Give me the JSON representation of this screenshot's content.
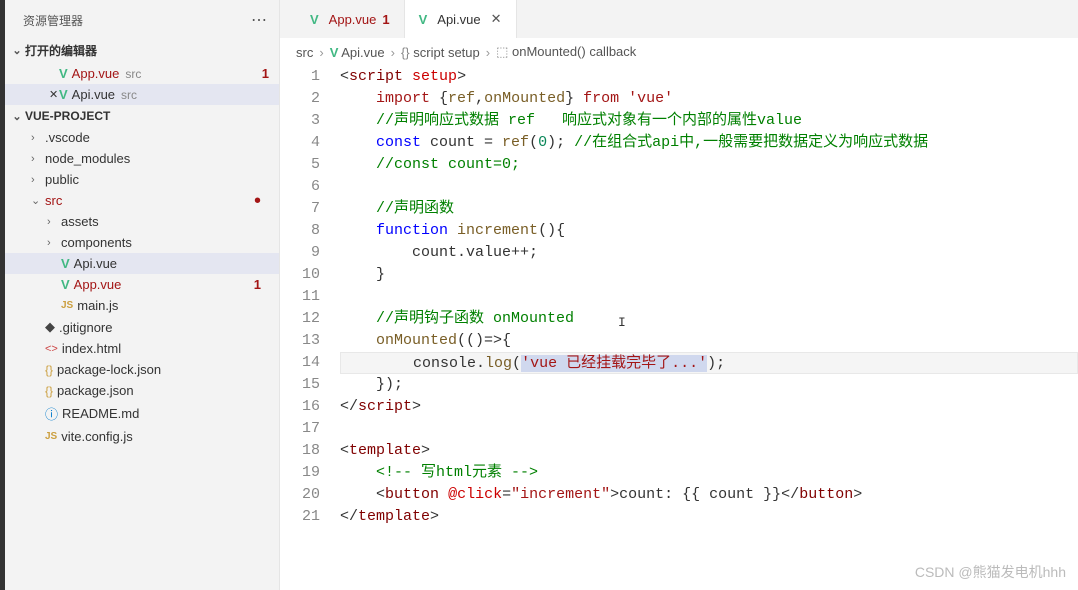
{
  "sidebar": {
    "title": "资源管理器",
    "openEditorsLabel": "打开的编辑器",
    "projectLabel": "VUE-PROJECT",
    "openEditors": [
      {
        "name": "App.vue",
        "folder": "src",
        "badge": "1",
        "modified": true
      },
      {
        "name": "Api.vue",
        "folder": "src",
        "active": true
      }
    ],
    "tree": [
      {
        "label": ".vscode",
        "type": "folder",
        "depth": 1
      },
      {
        "label": "node_modules",
        "type": "folder",
        "depth": 1
      },
      {
        "label": "public",
        "type": "folder",
        "depth": 1
      },
      {
        "label": "src",
        "type": "folder",
        "depth": 1,
        "open": true,
        "modified": true,
        "dot": true
      },
      {
        "label": "assets",
        "type": "folder",
        "depth": 2
      },
      {
        "label": "components",
        "type": "folder",
        "depth": 2
      },
      {
        "label": "Api.vue",
        "type": "vue",
        "depth": 2,
        "active": true
      },
      {
        "label": "App.vue",
        "type": "vue",
        "depth": 2,
        "modified": true,
        "badge": "1"
      },
      {
        "label": "main.js",
        "type": "js",
        "depth": 2
      },
      {
        "label": ".gitignore",
        "type": "git",
        "depth": 1
      },
      {
        "label": "index.html",
        "type": "html",
        "depth": 1
      },
      {
        "label": "package-lock.json",
        "type": "json",
        "depth": 1
      },
      {
        "label": "package.json",
        "type": "json",
        "depth": 1
      },
      {
        "label": "README.md",
        "type": "info",
        "depth": 1
      },
      {
        "label": "vite.config.js",
        "type": "js",
        "depth": 1
      }
    ]
  },
  "tabs": [
    {
      "name": "App.vue",
      "badge": "1",
      "modified": true
    },
    {
      "name": "Api.vue",
      "active": true,
      "close": true
    }
  ],
  "breadcrumb": {
    "parts": [
      "src",
      "Api.vue",
      "script setup",
      "onMounted() callback"
    ]
  },
  "code": {
    "lines": [
      {
        "n": 1,
        "html": "<span class='tok-punct'>&lt;</span><span class='tok-tag'>script</span> <span class='tok-attr'>setup</span><span class='tok-punct'>&gt;</span>"
      },
      {
        "n": 2,
        "html": "    <span class='tok-import'>import</span> {<span class='tok-func'>ref</span>,<span class='tok-func'>onMounted</span>} <span class='tok-import'>from</span> <span class='tok-string'>'vue'</span>"
      },
      {
        "n": 3,
        "html": "    <span class='tok-comment'>//声明响应式数据 ref   响应式对象有一个内部的属性value</span>"
      },
      {
        "n": 4,
        "html": "    <span class='tok-keyword'>const</span> count = <span class='tok-func'>ref</span>(<span class='tok-number'>0</span>); <span class='tok-comment'>//在组合式api中,一般需要把数据定义为响应式数据</span>"
      },
      {
        "n": 5,
        "html": "    <span class='tok-comment'>//const count=0;</span>"
      },
      {
        "n": 6,
        "html": ""
      },
      {
        "n": 7,
        "html": "    <span class='tok-comment'>//声明函数</span>"
      },
      {
        "n": 8,
        "html": "    <span class='tok-keyword'>function</span> <span class='tok-func'>increment</span>(){"
      },
      {
        "n": 9,
        "html": "        count.value++;"
      },
      {
        "n": 10,
        "html": "    }"
      },
      {
        "n": 11,
        "html": ""
      },
      {
        "n": 12,
        "html": "    <span class='tok-comment'>//声明钩子函数 onMounted</span>",
        "cursor": true
      },
      {
        "n": 13,
        "html": "    <span class='tok-func'>onMounted</span>(()=&gt;{"
      },
      {
        "n": 14,
        "html": "        console.<span class='tok-func'>log</span>(<span class='tok-highlight'><span class='tok-string'>'vue 已经挂载完毕了...'</span></span>);",
        "current": true
      },
      {
        "n": 15,
        "html": "    });"
      },
      {
        "n": 16,
        "html": "<span class='tok-punct'>&lt;/</span><span class='tok-tag'>script</span><span class='tok-punct'>&gt;</span>"
      },
      {
        "n": 17,
        "html": ""
      },
      {
        "n": 18,
        "html": "<span class='tok-punct'>&lt;</span><span class='tok-tag'>template</span><span class='tok-punct'>&gt;</span>"
      },
      {
        "n": 19,
        "html": "    <span class='tok-comment'>&lt;!-- 写html元素 --&gt;</span>"
      },
      {
        "n": 20,
        "html": "    <span class='tok-punct'>&lt;</span><span class='tok-tag'>button</span> <span class='tok-attr'>@click</span>=<span class='tok-string'>\"increment\"</span><span class='tok-punct'>&gt;</span>count: {{ count }}<span class='tok-punct'>&lt;/</span><span class='tok-tag'>button</span><span class='tok-punct'>&gt;</span>"
      },
      {
        "n": 21,
        "html": "<span class='tok-punct'>&lt;/</span><span class='tok-tag'>template</span><span class='tok-punct'>&gt;</span>"
      }
    ]
  },
  "watermark": "CSDN @熊猫发电机hhh"
}
